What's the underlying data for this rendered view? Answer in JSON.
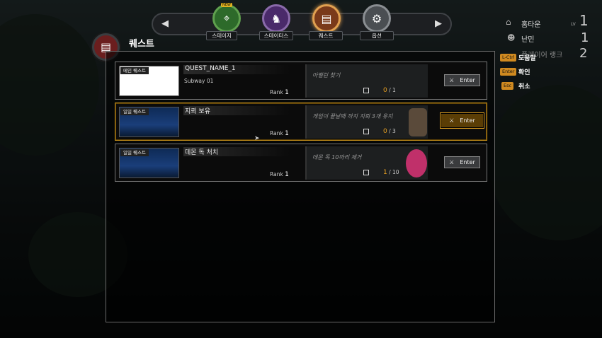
{
  "nav": {
    "new_badge": "NEW",
    "items": [
      {
        "label": "스테이지",
        "icon": "map-pin-icon",
        "color": "#2d6a2a"
      },
      {
        "label": "스테이터스",
        "icon": "wolf-head-icon",
        "color": "#4a2a6a"
      },
      {
        "label": "퀘스트",
        "icon": "scroll-icon",
        "color": "#7a3a1a"
      },
      {
        "label": "옵션",
        "icon": "gear-icon",
        "color": "#4a4e52"
      }
    ]
  },
  "title": "퀘스트",
  "quests": [
    {
      "type": "메인 퀘스트",
      "name": "QUEST_NAME_1",
      "subtitle": "Subway 01",
      "rank_label": "Rank",
      "rank": "1",
      "goal": "아벨린 찾기",
      "progress": "0",
      "total": "1",
      "enter": "Enter",
      "selected": false
    },
    {
      "type": "일일 퀘스트",
      "name": "지뢰 보유",
      "subtitle": "",
      "rank_label": "Rank",
      "rank": "1",
      "goal": "게임이 끝날때 까지 지뢰 3개 유지",
      "progress": "0",
      "total": "3",
      "enter": "Enter",
      "selected": true
    },
    {
      "type": "일일 퀘스트",
      "name": "데몬 독 처치",
      "subtitle": "",
      "rank_label": "Rank",
      "rank": "1",
      "goal": "데몬 독 10마리 제거",
      "progress": "1",
      "total": "10",
      "enter": "Enter",
      "selected": false
    }
  ],
  "hud": {
    "home": {
      "label": "홈타운",
      "lv": "LV",
      "value": "1",
      "icon": "house-icon"
    },
    "refugee": {
      "label": "난민",
      "value": "1",
      "icon": "person-icon"
    },
    "player_rank": {
      "label": "플레이어 랭크",
      "value": "2"
    },
    "keys": [
      {
        "key": "L-Ctrl",
        "label": "도움말"
      },
      {
        "key": "Enter",
        "label": "확인"
      },
      {
        "key": "Esc",
        "label": "취소"
      }
    ]
  }
}
